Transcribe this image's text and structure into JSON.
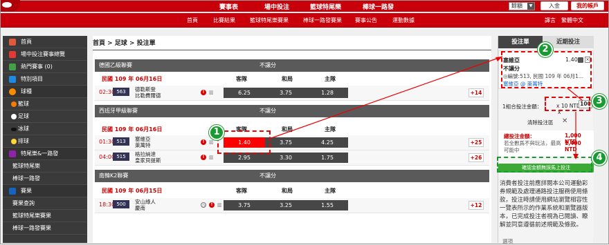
{
  "topnav": {
    "items": [
      "賽事表",
      "場中投注",
      "籃球特尾樂",
      "棒球一路發"
    ],
    "lang_select": "餘額",
    "deposit_label": "入金",
    "account_label": "我的帳戶"
  },
  "subnav": {
    "items": [
      "首頁",
      "比賽結果",
      "籃球特尾樂賽果",
      "棒球一路發賽果",
      "賽事公告",
      "運動數據"
    ],
    "right_items": [
      "譯言",
      "繁體中文"
    ]
  },
  "sidebar": {
    "items": [
      {
        "label": "首頁",
        "icon": "home-icon",
        "color": "#e05a3a"
      },
      {
        "label": "場中投注賽事總覽",
        "icon": "live-icon",
        "color": "#e53935"
      },
      {
        "label": "熱門賽事 (0)",
        "icon": "hot-icon",
        "color": "#43a047"
      },
      {
        "label": "特別項目",
        "icon": "calendar-icon",
        "color": "#1e88e5"
      },
      {
        "label": "球種",
        "icon": "ball-icon",
        "color": "#fb8c00"
      },
      {
        "label": "籃球",
        "icon": "basketball-icon",
        "color": "#f57c00"
      },
      {
        "label": "足球",
        "icon": "soccer-icon",
        "color": "#ffffff"
      },
      {
        "label": "冰球",
        "icon": "hockey-icon",
        "color": "#333333"
      },
      {
        "label": "排球",
        "icon": "volleyball-icon",
        "color": "#fdd835"
      },
      {
        "label": "特尾樂&一路發",
        "icon": "star-icon",
        "color": "#8e24aa"
      },
      {
        "label": "籃球特尾樂",
        "icon": "",
        "color": ""
      },
      {
        "label": "棒球一路發",
        "icon": "",
        "color": ""
      },
      {
        "label": "賽果",
        "icon": "trophy-icon",
        "color": "#1565c0"
      },
      {
        "label": "賽果查詢",
        "icon": "",
        "color": ""
      },
      {
        "label": "籃球特尾樂賽果",
        "icon": "",
        "color": ""
      },
      {
        "label": "棒球一路發賽果",
        "icon": "",
        "color": ""
      }
    ]
  },
  "main": {
    "breadcrumb": "首頁 > 足球 > 投注單",
    "leagues": [
      {
        "name": "德國乙級聯賽",
        "type": "不讓分",
        "date": "民國 109 年 06月16日",
        "headers": [
          "客隊",
          "和局",
          "主隊"
        ],
        "matches": [
          {
            "time": "02:30",
            "no": "563",
            "teams": "德勒斯登\n比勒費爾德",
            "odds": [
              "6.25",
              "3.75",
              "1.28"
            ],
            "more": "+14"
          }
        ]
      },
      {
        "name": "西班牙甲級聯賽",
        "type": "不讓分",
        "date": "民國 109 年 06月16日",
        "headers": [
          "客隊",
          "和局",
          "主隊"
        ],
        "matches": [
          {
            "time": "01:30",
            "no": "513",
            "teams": "塞維亞\n萊萬特",
            "odds": [
              "1.40",
              "3.75",
              "4.25"
            ],
            "more": "+25"
          },
          {
            "time": "04:00",
            "no": "515",
            "teams": "格拉納達\n皇家貝提斯",
            "odds": [
              "2.95",
              "3.30",
              "1.75"
            ],
            "more": "+26"
          }
        ]
      },
      {
        "name": "南韓K2聯賽",
        "type": "不讓分",
        "date": "民國 109 年 06月15日",
        "headers": [
          "客隊",
          "和局",
          "主隊"
        ],
        "matches": [
          {
            "time": "18:30",
            "no": "500",
            "teams": "安山綠人\n慶南",
            "odds": [
              "3.75",
              "3.25",
              "1.55"
            ],
            "more": "+12"
          }
        ]
      }
    ]
  },
  "slip": {
    "tab_active": "投注單",
    "tab_other": "近期投注",
    "pick_team": "塞維亞",
    "pick_odds": "1.40",
    "pick_type": "不讓分",
    "pick_detail": "◎編號:513, 民國 109 年 06月1...",
    "pick_match": "塞維亞 @ 萊萬特",
    "stake_label": "1組合投注金額：",
    "stake_multiplier": "x 10 NTD",
    "stake_value": "100",
    "stake_x": "x",
    "clear_label": "清除投注區",
    "total_label": "總投注金額：",
    "total_value": "1,000 NTD",
    "max_label": "若全數爲不與玩法，最高可能中",
    "max_value": "1,400 NTD",
    "confirm_label": "確認金額無誤馬上投注",
    "notice": "消費者投注前應詳閱本公司運動彩券規範及處理通路投注服務使用條款，投注時請使用網站瀏覽相容性一覽表所示的作業系統和瀏覽器版本，已完成投注者視為已閱讀、瞭解並同意遵循前述規範及條款。",
    "footer": "選項"
  },
  "annotations": [
    "1",
    "2",
    "3",
    "4"
  ],
  "colors": {
    "brand_red": "#c8000a",
    "confirm_green": "#3aaa35",
    "annotation_green": "#1a9a32",
    "selected_odds": "#ff0000"
  }
}
